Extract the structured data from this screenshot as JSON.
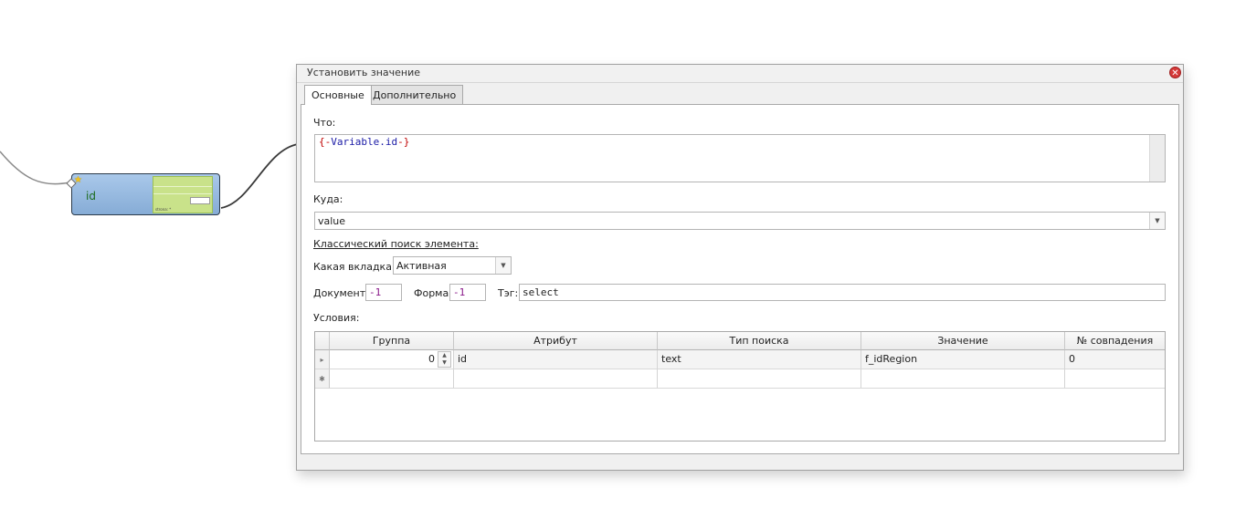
{
  "canvas": {
    "node": {
      "label": "id",
      "thumb_text": "strona: *"
    }
  },
  "dialog": {
    "title": "Установить значение",
    "close_glyph": "✕",
    "tabs": [
      {
        "label": "Основные"
      },
      {
        "label": "Дополнительно"
      }
    ],
    "what": {
      "label": "Что:",
      "open": "{-",
      "keyword": "Variable.id",
      "close": "-}"
    },
    "where": {
      "label": "Куда:",
      "value": "value"
    },
    "classic_search_label": "Классический поиск элемента:",
    "which_tab": {
      "label": "Какая вкладка:",
      "value": "Активная"
    },
    "document": {
      "label": "Документ:",
      "value": "-1"
    },
    "form": {
      "label": "Форма:",
      "value": "-1"
    },
    "tag": {
      "label": "Тэг:",
      "value": "select"
    },
    "conditions": {
      "label": "Условия:",
      "columns": [
        "Группа",
        "Атрибут",
        "Тип поиска",
        "Значение",
        "№ совпадения"
      ],
      "rows": [
        {
          "group": "0",
          "attribute": "id",
          "search_type": "text",
          "value": "f_idRegion",
          "match_no": "0"
        }
      ],
      "row_marker": "▸",
      "new_row_marker": "✱"
    }
  },
  "icons": {
    "close": "close-icon",
    "star": "star-icon",
    "dropdown": "chevron-down-icon"
  }
}
